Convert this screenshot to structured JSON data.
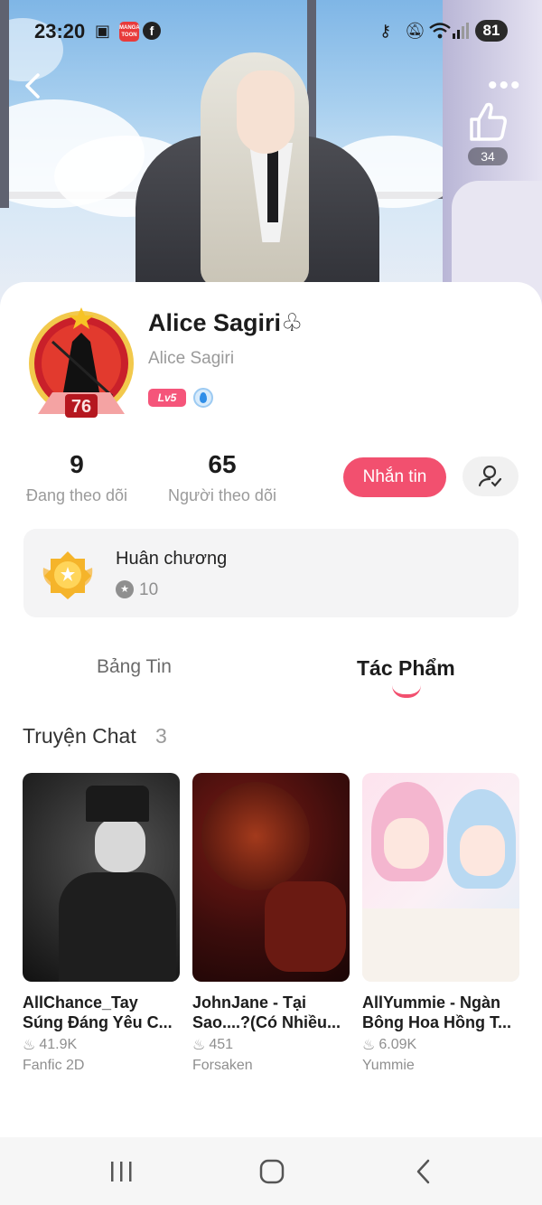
{
  "status_bar": {
    "time": "23:20",
    "app_badge": "MANGA TOON",
    "battery": "81",
    "icons": [
      "screenshot-icon",
      "mangatoon-app-icon",
      "facebook-icon",
      "vpn-key-icon",
      "mute-icon",
      "wifi-icon",
      "signal-icon",
      "battery-icon"
    ]
  },
  "header": {
    "back_icon": "chevron-left-icon",
    "more_icon": "more-dots-icon",
    "like_icon": "thumbs-up-icon",
    "like_count": "34"
  },
  "profile": {
    "display_name": "Alice Sagiri♧",
    "username": "Alice Sagiri",
    "level_badge": "Lv5",
    "avatar_frame_number": "76"
  },
  "stats": {
    "following_count": "9",
    "following_label": "Đang theo dõi",
    "followers_count": "65",
    "followers_label": "Người theo dõi"
  },
  "actions": {
    "message_label": "Nhắn tin",
    "follow_icon": "user-follow-icon"
  },
  "medal": {
    "title": "Huân chương",
    "count": "10"
  },
  "tabs": [
    {
      "label": "Bảng Tin",
      "active": false
    },
    {
      "label": "Tác Phẩm",
      "active": true
    }
  ],
  "section": {
    "title": "Truyện Chat",
    "count": "3"
  },
  "stories": [
    {
      "title": "AllChance_Tay Súng Đáng Yêu C...",
      "views": "41.9K",
      "tag": "Fanfic 2D"
    },
    {
      "title": "JohnJane - Tại Sao....?(Có Nhiều...",
      "views": "451",
      "tag": "Forsaken"
    },
    {
      "title": "AllYummie - Ngàn Bông Hoa Hồng T...",
      "views": "6.09K",
      "tag": "Yummie"
    }
  ],
  "colors": {
    "accent": "#f2506f",
    "muted_text": "#9a9a9a",
    "card_bg": "#f4f4f5"
  },
  "nav": {
    "recent_icon": "recent-apps-icon",
    "home_icon": "home-icon",
    "back_icon": "nav-back-icon"
  }
}
